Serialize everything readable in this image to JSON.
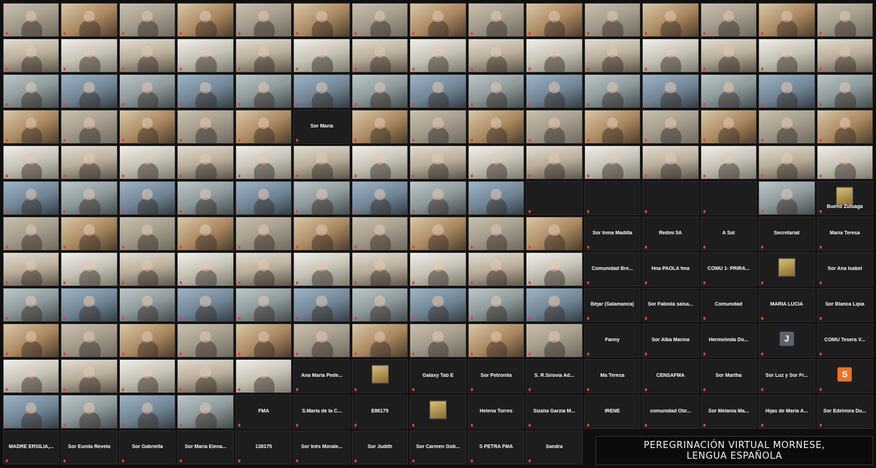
{
  "grid": {
    "columns": 15,
    "rows": 13,
    "name_tiles": [
      {
        "row": 3,
        "col": 5,
        "label": "Sor Maria"
      },
      {
        "row": 5,
        "col": 14,
        "label": "Bueno Zuluaga",
        "thumb": "image-thumb"
      },
      {
        "row": 6,
        "col": 10,
        "label": "Sor Inma Madilla"
      },
      {
        "row": 6,
        "col": 11,
        "label": "Redmi 5A"
      },
      {
        "row": 6,
        "col": 12,
        "label": "A Sol"
      },
      {
        "row": 6,
        "col": 13,
        "label": "Secretariat"
      },
      {
        "row": 6,
        "col": 14,
        "label": "Maria Teresa"
      },
      {
        "row": 7,
        "col": 10,
        "label": "Comunidad Bre..."
      },
      {
        "row": 7,
        "col": 11,
        "label": "Hna PAOLA fma"
      },
      {
        "row": 7,
        "col": 12,
        "label": "COMU 1- PRIRA..."
      },
      {
        "row": 7,
        "col": 13,
        "label": "",
        "thumb": "image-thumb"
      },
      {
        "row": 7,
        "col": 14,
        "label": "Sor Ana Isabel"
      },
      {
        "row": 8,
        "col": 10,
        "label": "Béjar (Salamanca)"
      },
      {
        "row": 8,
        "col": 11,
        "label": "Sor Fabiola salsa..."
      },
      {
        "row": 8,
        "col": 12,
        "label": "Comunidad"
      },
      {
        "row": 8,
        "col": 13,
        "label": "MARIA LUCIA"
      },
      {
        "row": 8,
        "col": 14,
        "label": "Sor Blanca Lipia"
      },
      {
        "row": 9,
        "col": 10,
        "label": "Fanny"
      },
      {
        "row": 9,
        "col": 11,
        "label": "Sor Alba Marina"
      },
      {
        "row": 9,
        "col": 12,
        "label": "Hermelinda Do..."
      },
      {
        "row": 9,
        "col": 13,
        "label": "",
        "avatar": "J",
        "avatar_color": "#5a6470"
      },
      {
        "row": 9,
        "col": 14,
        "label": "COMU Tesera V..."
      },
      {
        "row": 10,
        "col": 5,
        "label": "Ana María Pede..."
      },
      {
        "row": 10,
        "col": 6,
        "label": "",
        "thumb": "image-thumb"
      },
      {
        "row": 10,
        "col": 7,
        "label": "Galaxy Tab E"
      },
      {
        "row": 10,
        "col": 8,
        "label": "Sor Petronila"
      },
      {
        "row": 10,
        "col": 9,
        "label": "S. R.Sirovia Ad..."
      },
      {
        "row": 10,
        "col": 10,
        "label": "Ma Teresa"
      },
      {
        "row": 10,
        "col": 11,
        "label": "CENSAFMA"
      },
      {
        "row": 10,
        "col": 12,
        "label": "Sor Martha"
      },
      {
        "row": 10,
        "col": 13,
        "label": "Sor Luz y Sor Fr..."
      },
      {
        "row": 10,
        "col": 14,
        "label": "",
        "avatar": "S",
        "avatar_color": "#e8742a"
      },
      {
        "row": 11,
        "col": 4,
        "label": "FMA"
      },
      {
        "row": 11,
        "col": 5,
        "label": "S.María de la C..."
      },
      {
        "row": 11,
        "col": 6,
        "label": "E86175"
      },
      {
        "row": 11,
        "col": 7,
        "label": "",
        "thumb": "image-thumb"
      },
      {
        "row": 11,
        "col": 8,
        "label": "Helena Torres"
      },
      {
        "row": 11,
        "col": 9,
        "label": "Sizalia Garzia M..."
      },
      {
        "row": 11,
        "col": 10,
        "label": "IRENE"
      },
      {
        "row": 11,
        "col": 11,
        "label": "comunidad Obr..."
      },
      {
        "row": 11,
        "col": 12,
        "label": "Sor Melania Ma..."
      },
      {
        "row": 11,
        "col": 13,
        "label": "Hijas de María A..."
      },
      {
        "row": 11,
        "col": 14,
        "label": "Sor Edelmira Du..."
      },
      {
        "row": 12,
        "col": 0,
        "label": "MADRE ERSILIA,..."
      },
      {
        "row": 12,
        "col": 1,
        "label": "Sor Eunila Revelo"
      },
      {
        "row": 12,
        "col": 2,
        "label": "Sor Gabriella"
      },
      {
        "row": 12,
        "col": 3,
        "label": "Sor María Elena..."
      },
      {
        "row": 12,
        "col": 4,
        "label": "138175"
      },
      {
        "row": 12,
        "col": 5,
        "label": "Sor Inés Morale..."
      },
      {
        "row": 12,
        "col": 6,
        "label": "Sor Judith"
      },
      {
        "row": 12,
        "col": 7,
        "label": "Sor Carmen Goti..."
      },
      {
        "row": 12,
        "col": 8,
        "label": "S PETRA FMA"
      },
      {
        "row": 12,
        "col": 9,
        "label": "Sandra"
      }
    ],
    "empty_tiles": [
      {
        "row": 5,
        "col": 9
      },
      {
        "row": 5,
        "col": 10
      },
      {
        "row": 5,
        "col": 11
      },
      {
        "row": 5,
        "col": 12
      }
    ]
  },
  "banner": {
    "line1": "PEREGRINACIÓN VIRTUAL MORNESE,",
    "line2": "LENGUA ESPAÑOLA"
  }
}
